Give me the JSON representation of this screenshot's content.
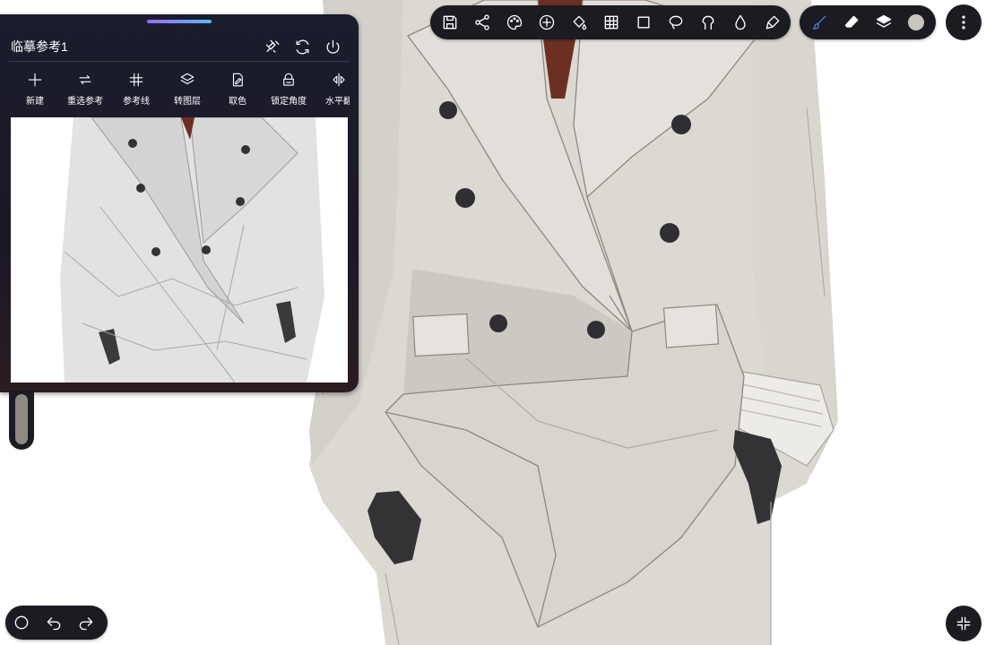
{
  "reference_panel": {
    "title": "临摹参考1",
    "actions": [
      {
        "label": "新建",
        "icon": "plus-icon"
      },
      {
        "label": "重选参考",
        "icon": "swap-icon"
      },
      {
        "label": "参考线",
        "icon": "grid-hash-icon"
      },
      {
        "label": "转图层",
        "icon": "layers-icon"
      },
      {
        "label": "取色",
        "icon": "color-picker-icon"
      },
      {
        "label": "锁定角度",
        "icon": "lock-angle-icon"
      },
      {
        "label": "水平翻",
        "icon": "flip-horizontal-icon"
      }
    ]
  },
  "top_toolbar": {
    "tools": [
      "save-icon",
      "share-icon",
      "palette-icon",
      "add-icon",
      "fill-icon",
      "grid-icon",
      "transform-icon",
      "lasso-icon",
      "liquify-icon",
      "blur-icon",
      "smudge-icon"
    ]
  },
  "brush_toolbar": {
    "tools": [
      "brush-icon",
      "eraser-icon",
      "layers-icon",
      "color-swatch-icon"
    ],
    "active_tool": "brush-icon",
    "brush_color": "#4d7fe0",
    "current_color": "#c8c4be"
  },
  "colors": {
    "ui_dark": "#1b1b22",
    "coat_main": "#d6d2cc",
    "coat_shade": "#bdb8b1",
    "button_dark": "#2f2f33",
    "glove": "#333335"
  }
}
